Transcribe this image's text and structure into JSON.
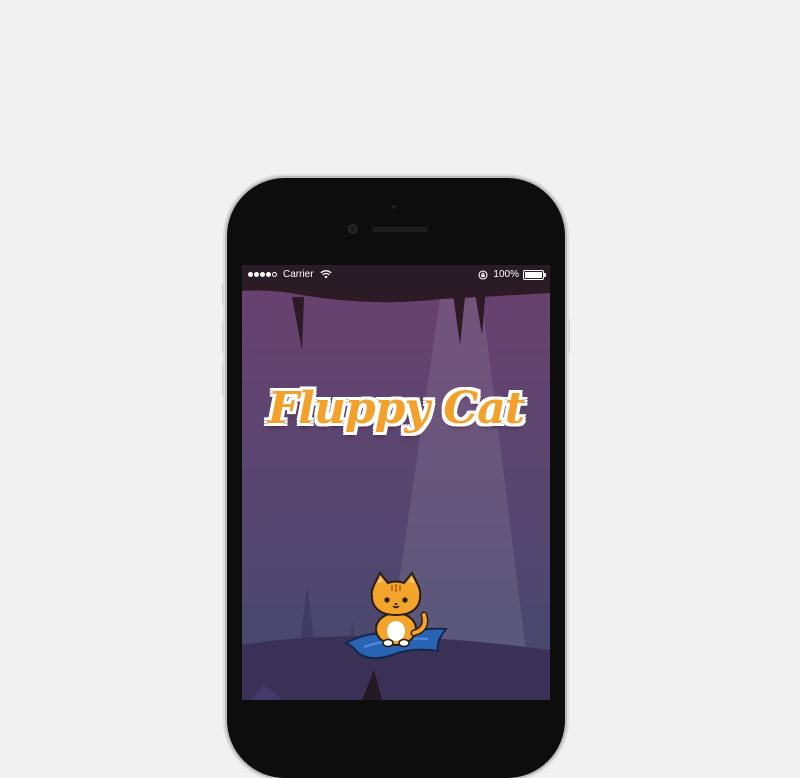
{
  "status_bar": {
    "carrier": "Carrier",
    "battery_percent": "100%",
    "signal_bars_filled": 4,
    "signal_bars_total": 5
  },
  "game": {
    "title": "Fluppy Cat"
  },
  "colors": {
    "title_fill": "#f4a12c",
    "title_outline": "#ffffff",
    "sky_top": "#6a416d",
    "sky_bottom": "#45486f",
    "cat_body": "#f3a42a",
    "carpet": "#2a63b4"
  },
  "icons": [
    "wifi-icon",
    "rotation-lock-icon",
    "battery-icon",
    "cat-character-icon",
    "magic-carpet-icon"
  ]
}
